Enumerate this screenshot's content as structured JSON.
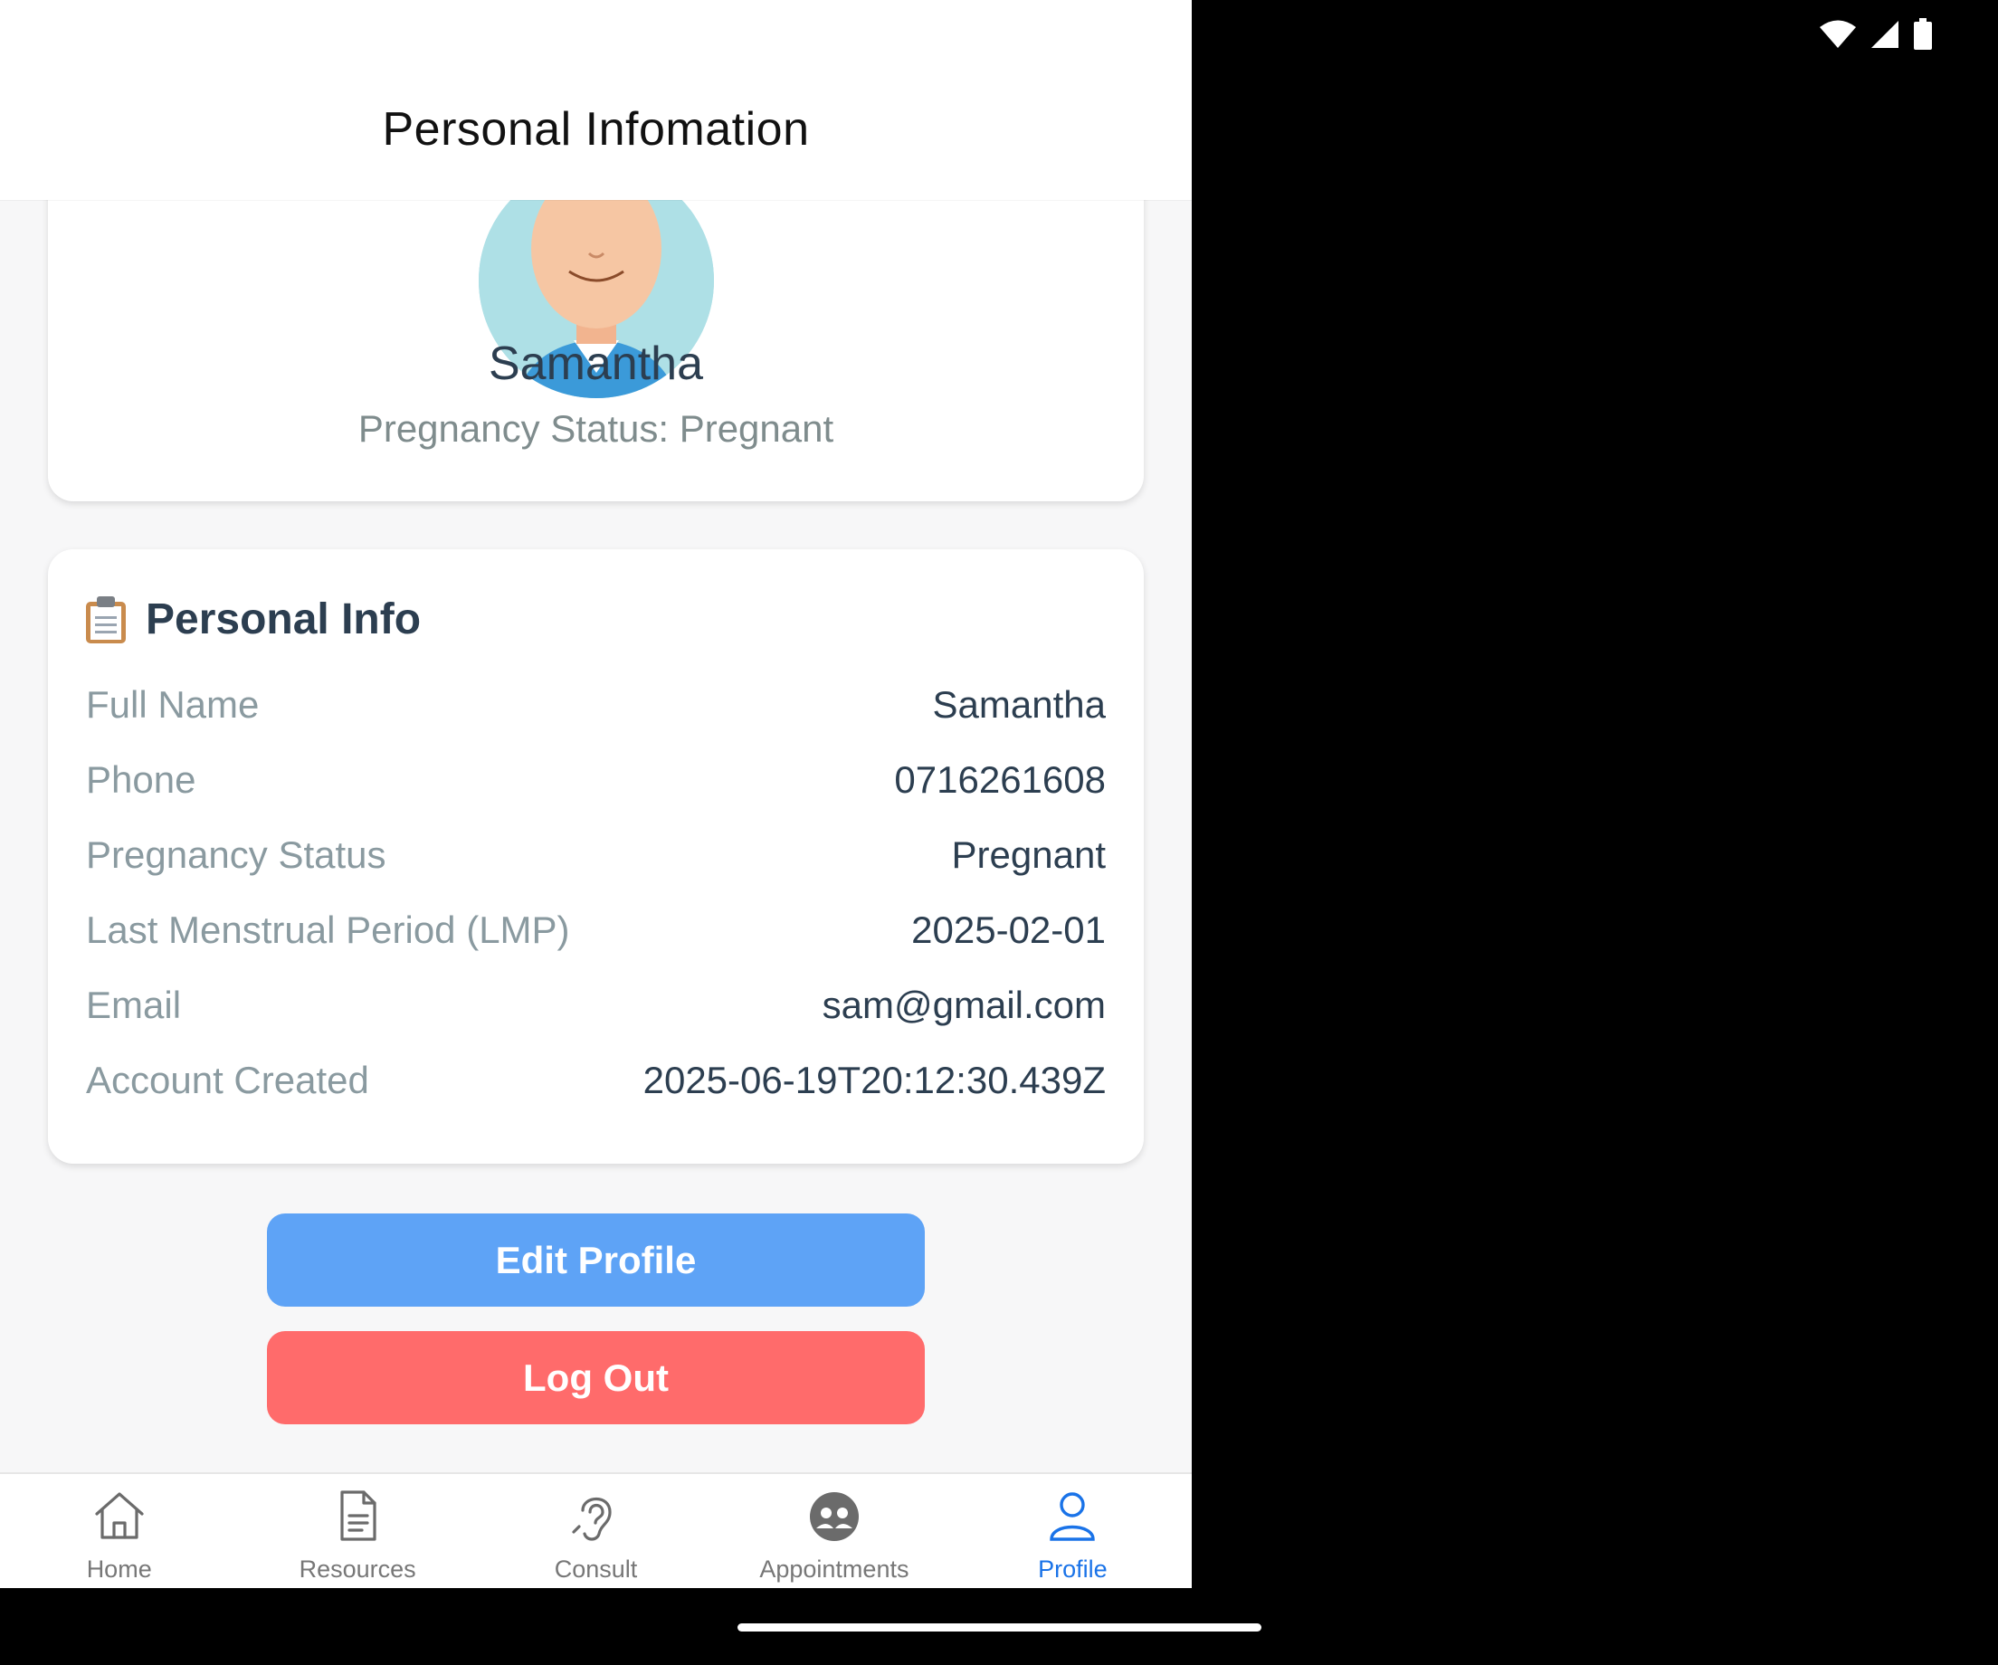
{
  "header": {
    "title": "Personal Infomation"
  },
  "profile": {
    "name": "Samantha",
    "status_line": "Pregnancy Status: Pregnant"
  },
  "personal_info": {
    "heading": "Personal Info",
    "heading_icon": "clipboard-icon",
    "rows": [
      {
        "label": "Full Name",
        "value": "Samantha"
      },
      {
        "label": "Phone",
        "value": "0716261608"
      },
      {
        "label": "Pregnancy Status",
        "value": "Pregnant"
      },
      {
        "label": "Last Menstrual Period (LMP)",
        "value": "2025-02-01"
      },
      {
        "label": "Email",
        "value": "sam@gmail.com"
      },
      {
        "label": "Account Created",
        "value": "2025-06-19T20:12:30.439Z"
      }
    ]
  },
  "actions": {
    "edit_label": "Edit Profile",
    "logout_label": "Log Out"
  },
  "tabs": [
    {
      "label": "Home",
      "icon": "home-icon"
    },
    {
      "label": "Resources",
      "icon": "document-icon"
    },
    {
      "label": "Consult",
      "icon": "ear-icon"
    },
    {
      "label": "Appointments",
      "icon": "people-icon"
    },
    {
      "label": "Profile",
      "icon": "person-icon",
      "active": true
    }
  ],
  "colors": {
    "accent": "#1a73e8",
    "edit_button": "#5ea3f6",
    "logout_button": "#ff6b6b",
    "text_dark": "#2c3e50",
    "text_muted": "#7f8c8d"
  }
}
